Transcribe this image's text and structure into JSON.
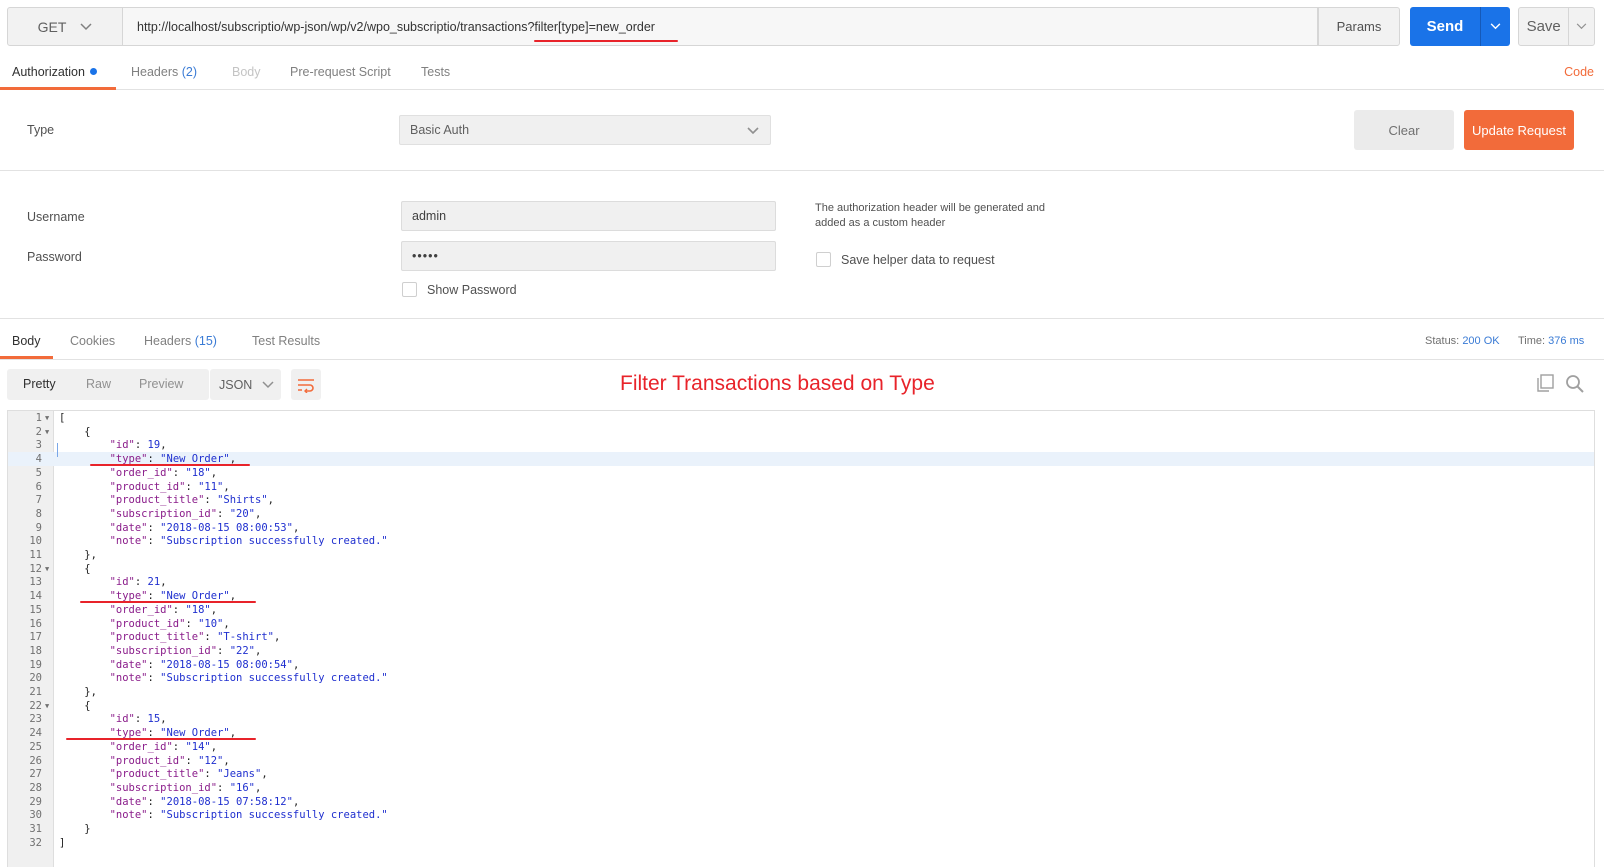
{
  "request": {
    "method": "GET",
    "url": "http://localhost/subscriptio/wp-json/wp/v2/wpo_subscriptio/transactions?filter[type]=new_order",
    "params_label": "Params",
    "send_label": "Send",
    "save_label": "Save"
  },
  "request_tabs": {
    "authorization": "Authorization",
    "headers": "Headers",
    "headers_count": "(2)",
    "body": "Body",
    "prerequest": "Pre-request Script",
    "tests": "Tests",
    "code": "Code"
  },
  "auth": {
    "type_label": "Type",
    "type_value": "Basic Auth",
    "clear_label": "Clear",
    "update_label": "Update Request",
    "username_label": "Username",
    "username_value": "admin",
    "password_label": "Password",
    "password_value": "•••••",
    "show_password_label": "Show Password",
    "note": "The authorization header will be generated and added as a custom header",
    "save_helper_label": "Save helper data to request"
  },
  "response_tabs": {
    "body": "Body",
    "cookies": "Cookies",
    "headers": "Headers",
    "headers_count": "(15)",
    "test_results": "Test Results",
    "status_label": "Status:",
    "status_value": "200 OK",
    "time_label": "Time:",
    "time_value": "376 ms"
  },
  "viewer": {
    "pretty": "Pretty",
    "raw": "Raw",
    "preview": "Preview",
    "format": "JSON"
  },
  "annotation": "Filter Transactions based on Type",
  "transactions": [
    {
      "id": "19",
      "type": "New Order",
      "order_id": "18",
      "product_id": "11",
      "product_title": "Shirts",
      "subscription_id": "20",
      "date": "2018-08-15 08:00:53",
      "note": "Subscription successfully created."
    },
    {
      "id": "21",
      "type": "New Order",
      "order_id": "18",
      "product_id": "10",
      "product_title": "T-shirt",
      "subscription_id": "22",
      "date": "2018-08-15 08:00:54",
      "note": "Subscription successfully created."
    },
    {
      "id": "15",
      "type": "New Order",
      "order_id": "14",
      "product_id": "12",
      "product_title": "Jeans",
      "subscription_id": "16",
      "date": "2018-08-15 07:58:12",
      "note": "Subscription successfully created."
    }
  ],
  "colors": {
    "accent": "#f26b3a",
    "send": "#1a73e8",
    "annotation_red": "#e8232a"
  }
}
